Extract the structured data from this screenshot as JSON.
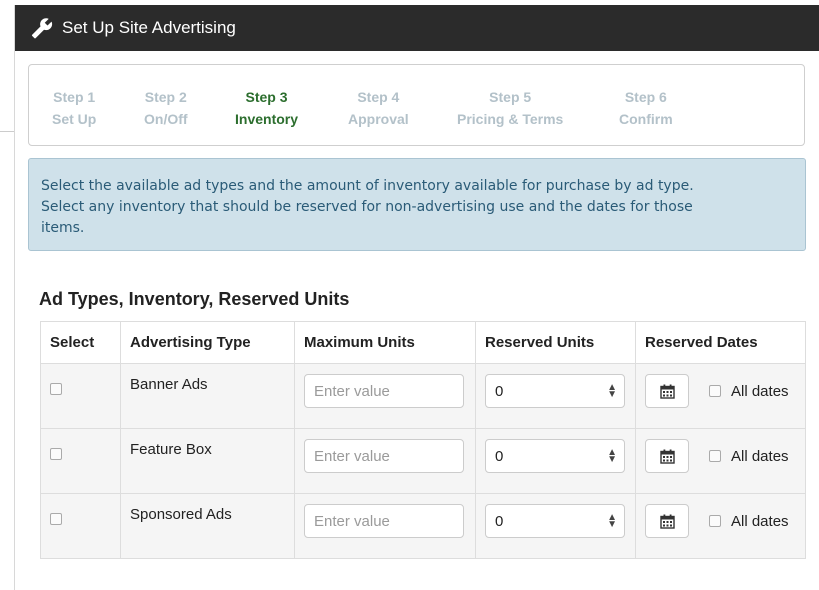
{
  "header": {
    "title": "Set Up Site Advertising",
    "icon": "wrench-icon"
  },
  "steps": [
    {
      "number": "Step 1",
      "label": "Set Up",
      "active": false
    },
    {
      "number": "Step 2",
      "label": "On/Off",
      "active": false
    },
    {
      "number": "Step 3",
      "label": "Inventory",
      "active": true
    },
    {
      "number": "Step 4",
      "label": "Approval",
      "active": false
    },
    {
      "number": "Step 5",
      "label": "Pricing & Terms",
      "active": false
    },
    {
      "number": "Step 6",
      "label": "Confirm",
      "active": false
    }
  ],
  "info": {
    "line1": "Select the available ad types and the amount of inventory available for purchase by ad type.",
    "line2": "Select any inventory that should be reserved for non-advertising use and the dates for those",
    "line3": "items."
  },
  "section_title": "Ad Types, Inventory, Reserved Units",
  "table": {
    "columns": [
      "Select",
      "Advertising Type",
      "Maximum Units",
      "Reserved Units",
      "Reserved Dates"
    ],
    "rows": [
      {
        "type": "Banner Ads",
        "max_placeholder": "Enter value",
        "reserved_value": "0",
        "all_dates": "All dates"
      },
      {
        "type": "Feature Box",
        "max_placeholder": "Enter value",
        "reserved_value": "0",
        "all_dates": "All dates"
      },
      {
        "type": "Sponsored Ads",
        "max_placeholder": "Enter value",
        "reserved_value": "0",
        "all_dates": "All dates"
      }
    ]
  },
  "colors": {
    "header_bg": "#2b2b2b",
    "active_step": "#2c6e2e",
    "inactive_step": "#b3c1c9",
    "info_bg": "#cfe1ea",
    "info_text": "#2a5b77"
  }
}
